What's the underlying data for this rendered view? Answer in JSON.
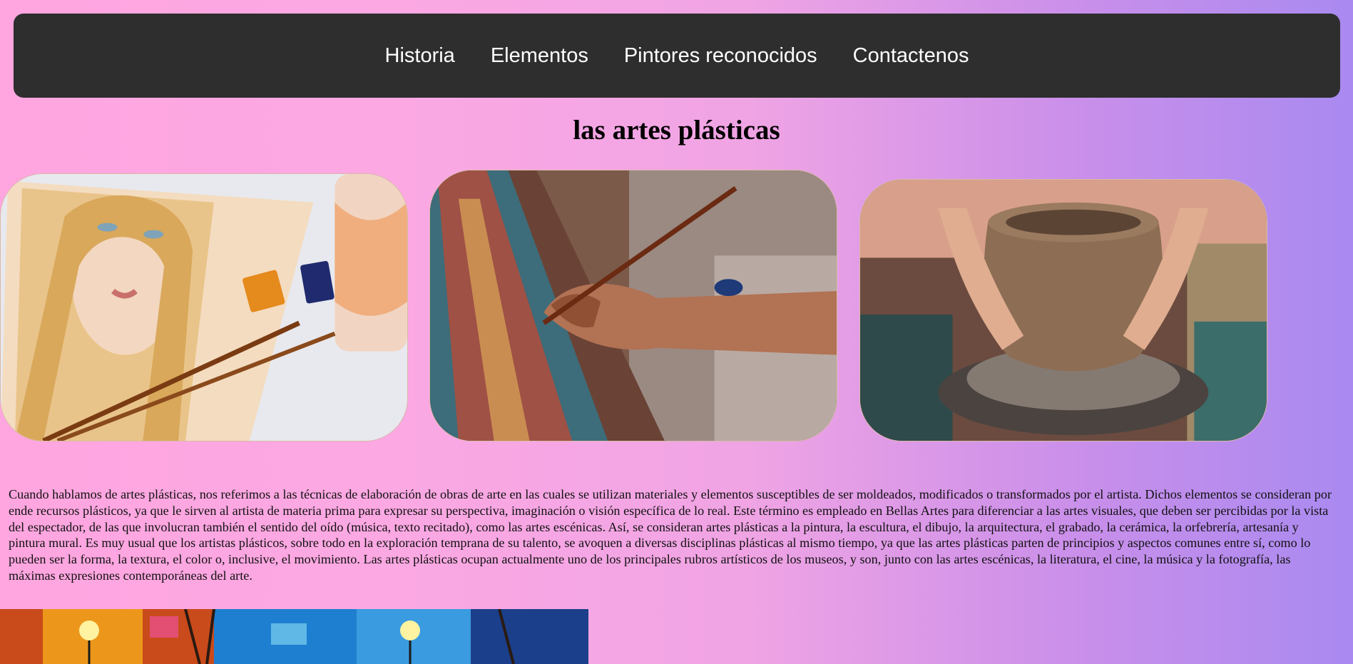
{
  "nav": {
    "items": [
      {
        "label": "Historia"
      },
      {
        "label": "Elementos"
      },
      {
        "label": "Pintores reconocidos"
      },
      {
        "label": "Contactenos"
      }
    ]
  },
  "main": {
    "title": "las artes plásticas",
    "intro": "Cuando hablamos de artes plásticas, nos referimos a las técnicas de elaboración de obras de arte en las cuales se utilizan materiales y elementos susceptibles de ser moldeados, modificados o transformados por el artista. Dichos elementos se consideran por ende recursos plásticos, ya que le sirven al artista de materia prima para expresar su perspectiva, imaginación o visión específica de lo real. Este término es empleado en Bellas Artes para diferenciar a las artes visuales, que deben ser percibidas por la vista del espectador, de las que involucran también el sentido del oído (música, texto recitado), como las artes escénicas. Así, se consideran artes plásticas a la pintura, la escultura, el dibujo, la arquitectura, el grabado, la cerámica, la orfebrería, artesanía y pintura mural. Es muy usual que los artistas plásticos, sobre todo en la exploración temprana de su talento, se avoquen a diversas disciplinas plásticas al mismo tiempo, ya que las artes plásticas parten de principios y aspectos comunes entre sí, como lo pueden ser la forma, la textura, el color o, inclusive, el movimiento. Las artes plásticas ocupan actualmente uno de los principales rubros artísticos de los museos, y son, junto con las artes escénicas, la literatura, el cine, la música y la fotografía, las máximas expresiones contemporáneas del arte."
  },
  "colors": {
    "navbar_bg": "#2e2e2e",
    "nav_text": "#ffffff",
    "gradient_start": "#ffa6e0",
    "gradient_end": "#a98af0"
  }
}
